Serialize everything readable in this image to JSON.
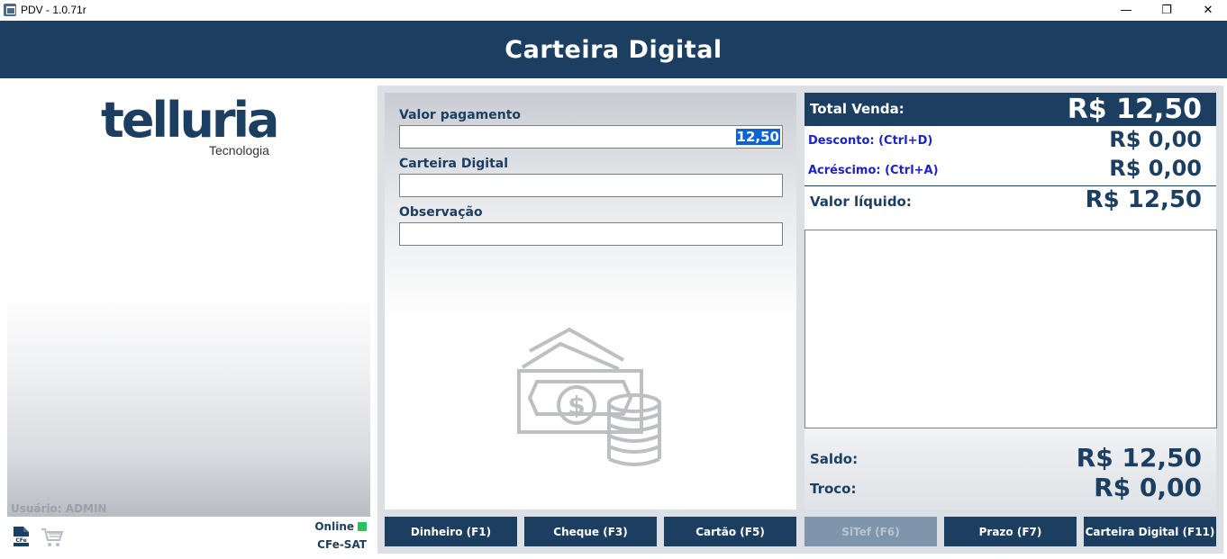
{
  "window": {
    "title": "PDV - 1.0.71r",
    "minimize": "—",
    "maximize": "❐",
    "close": "✕"
  },
  "header": {
    "title": "Carteira Digital"
  },
  "sidebar": {
    "logo_main": "telluria",
    "logo_sub": "Tecnologia",
    "user_label": "Usuário: ADMIN",
    "status_online": "Online",
    "status_sat": "CFe-SAT",
    "cfe_icon_text": "CFe",
    "online_color": "#22c55e"
  },
  "form": {
    "valor_label": "Valor pagamento",
    "valor_value": "12,50",
    "carteira_label": "Carteira Digital",
    "carteira_value": "",
    "observacao_label": "Observação",
    "observacao_value": ""
  },
  "summary": {
    "total_label": "Total Venda:",
    "total_value": "R$ 12,50",
    "desconto_label": "Desconto: (Ctrl+D)",
    "desconto_value": "R$ 0,00",
    "acrescimo_label": "Acréscimo: (Ctrl+A)",
    "acrescimo_value": "R$ 0,00",
    "liquido_label": "Valor líquido:",
    "liquido_value": "R$ 12,50",
    "saldo_label": "Saldo:",
    "saldo_value": "R$ 12,50",
    "troco_label": "Troco:",
    "troco_value": "R$ 0,00"
  },
  "buttons": [
    {
      "label": "Dinheiro (F1)",
      "enabled": true
    },
    {
      "label": "Cheque (F3)",
      "enabled": true
    },
    {
      "label": "Cartão (F5)",
      "enabled": true
    },
    {
      "label": "SiTef (F6)",
      "enabled": false
    },
    {
      "label": "Prazo (F7)",
      "enabled": true
    },
    {
      "label": "Carteira Digital (F11)",
      "enabled": true
    }
  ],
  "colors": {
    "brand_navy": "#1b3e61",
    "link_blue": "#1a22c8",
    "selection_blue": "#0a64d6"
  },
  "icons": [
    "app-icon",
    "cfe-document-icon",
    "shopping-cart-icon",
    "money-cash-icon",
    "coins-icon"
  ]
}
